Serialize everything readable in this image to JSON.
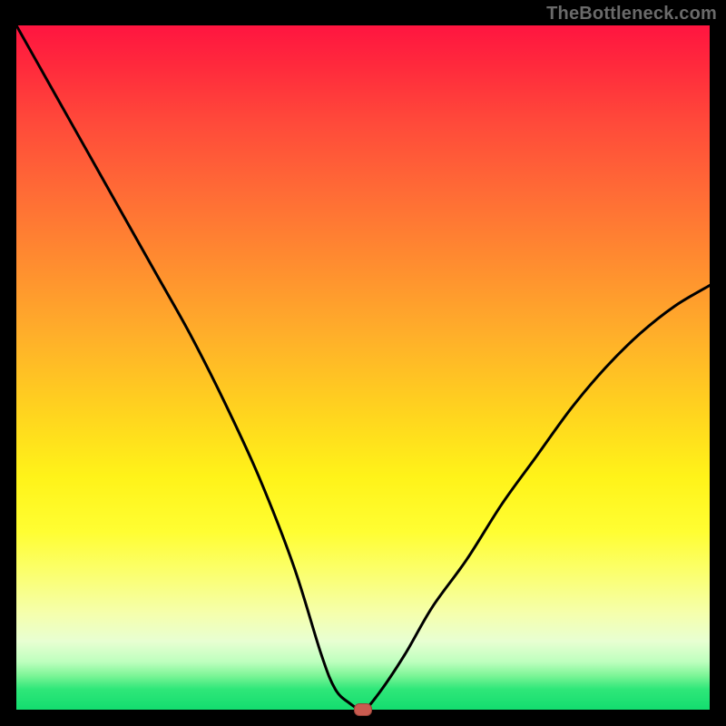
{
  "watermark": {
    "text": "TheBottleneck.com"
  },
  "colors": {
    "curve_stroke": "#000000",
    "marker_fill": "#c95b50",
    "marker_border": "#974238"
  },
  "chart_data": {
    "type": "line",
    "title": "",
    "xlabel": "",
    "ylabel": "",
    "xlim": [
      0,
      100
    ],
    "ylim": [
      0,
      100
    ],
    "grid": false,
    "legend": false,
    "series": [
      {
        "name": "bottleneck-curve",
        "x": [
          0,
          5,
          10,
          15,
          20,
          25,
          30,
          35,
          40,
          44,
          46,
          48,
          50,
          52,
          56,
          60,
          65,
          70,
          75,
          80,
          85,
          90,
          95,
          100
        ],
        "values": [
          100,
          91,
          82,
          73,
          64,
          55,
          45,
          34,
          21,
          8,
          3,
          1,
          0,
          2,
          8,
          15,
          22,
          30,
          37,
          44,
          50,
          55,
          59,
          62
        ]
      }
    ],
    "marker": {
      "x": 50,
      "y": 0,
      "shape": "rounded-rect",
      "label": ""
    }
  }
}
